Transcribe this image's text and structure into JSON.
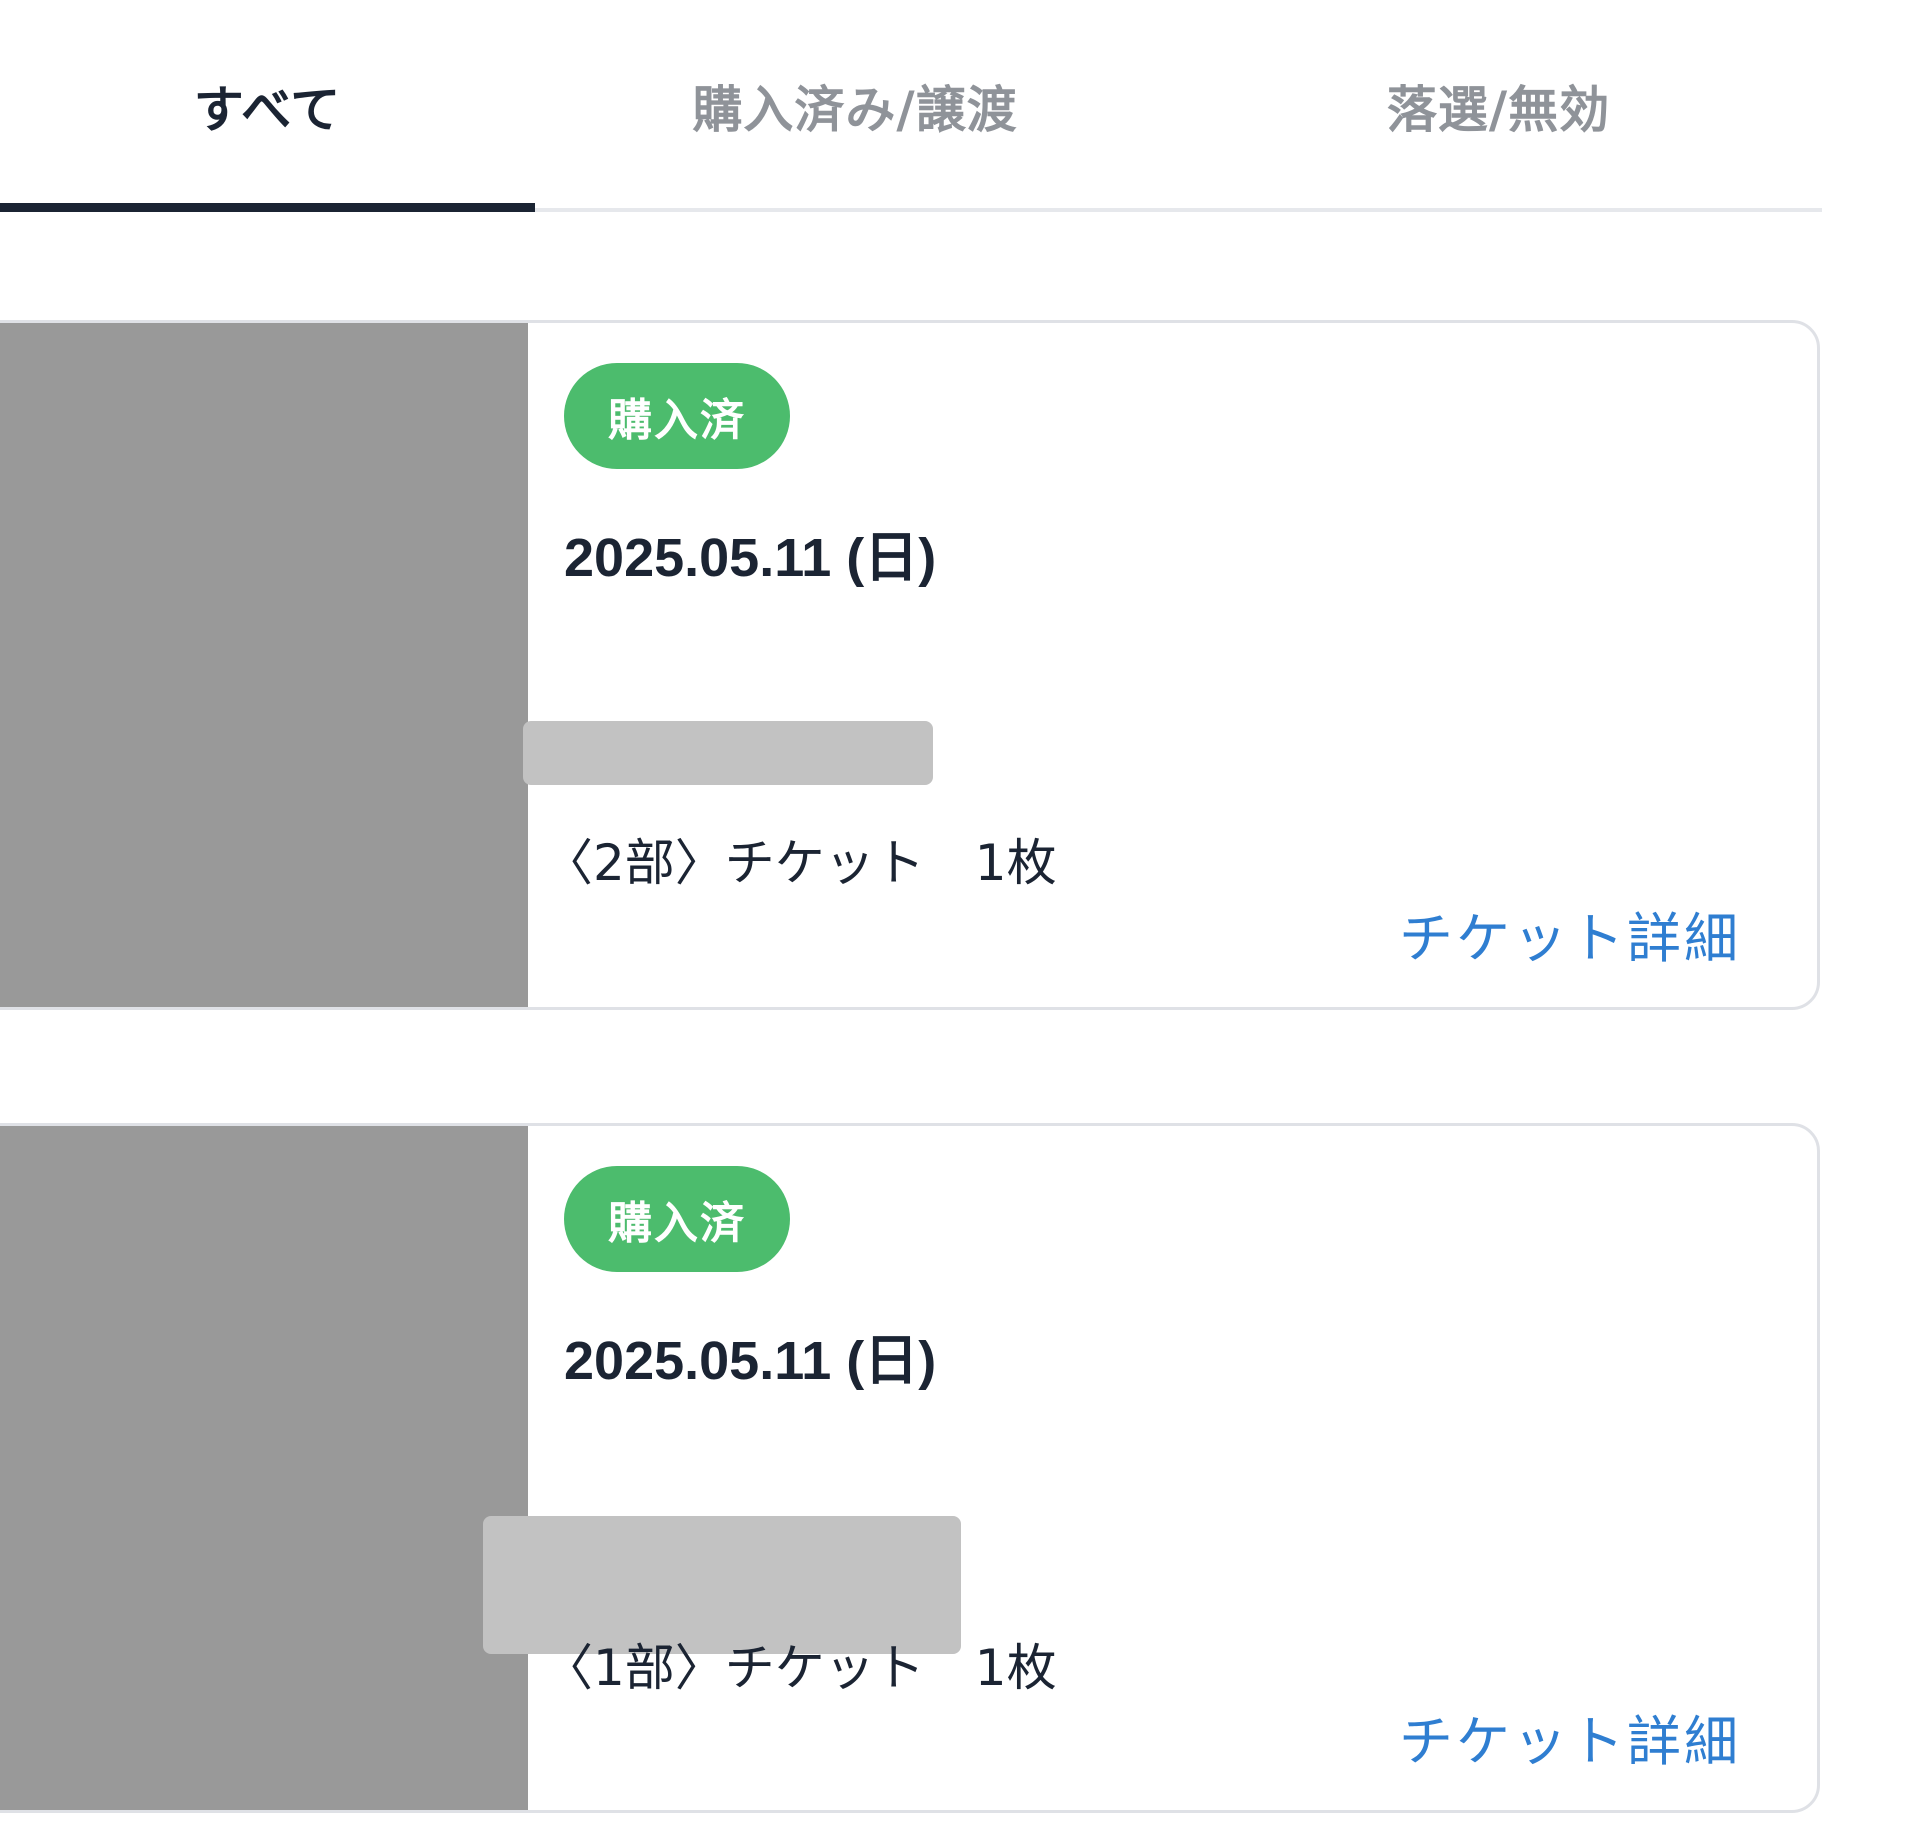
{
  "tabs": [
    {
      "label": "すべて",
      "active": true
    },
    {
      "label": "購入済み/譲渡",
      "active": false
    },
    {
      "label": "落選/無効",
      "active": false
    }
  ],
  "tickets": [
    {
      "status": "購入済",
      "date": "2025.05.11 (日)",
      "summary": "〈2部〉チケット　1枚",
      "detail_link": "チケット詳細"
    },
    {
      "status": "購入済",
      "date": "2025.05.11 (日)",
      "summary": "〈1部〉チケット　1枚",
      "detail_link": "チケット詳細"
    }
  ],
  "colors": {
    "active_text": "#1b2433",
    "inactive_text": "#8f9399",
    "badge_green": "#4cbc6d",
    "link_blue": "#2f7ed1",
    "image_placeholder": "#999999",
    "redaction": "#c2c2c2"
  }
}
